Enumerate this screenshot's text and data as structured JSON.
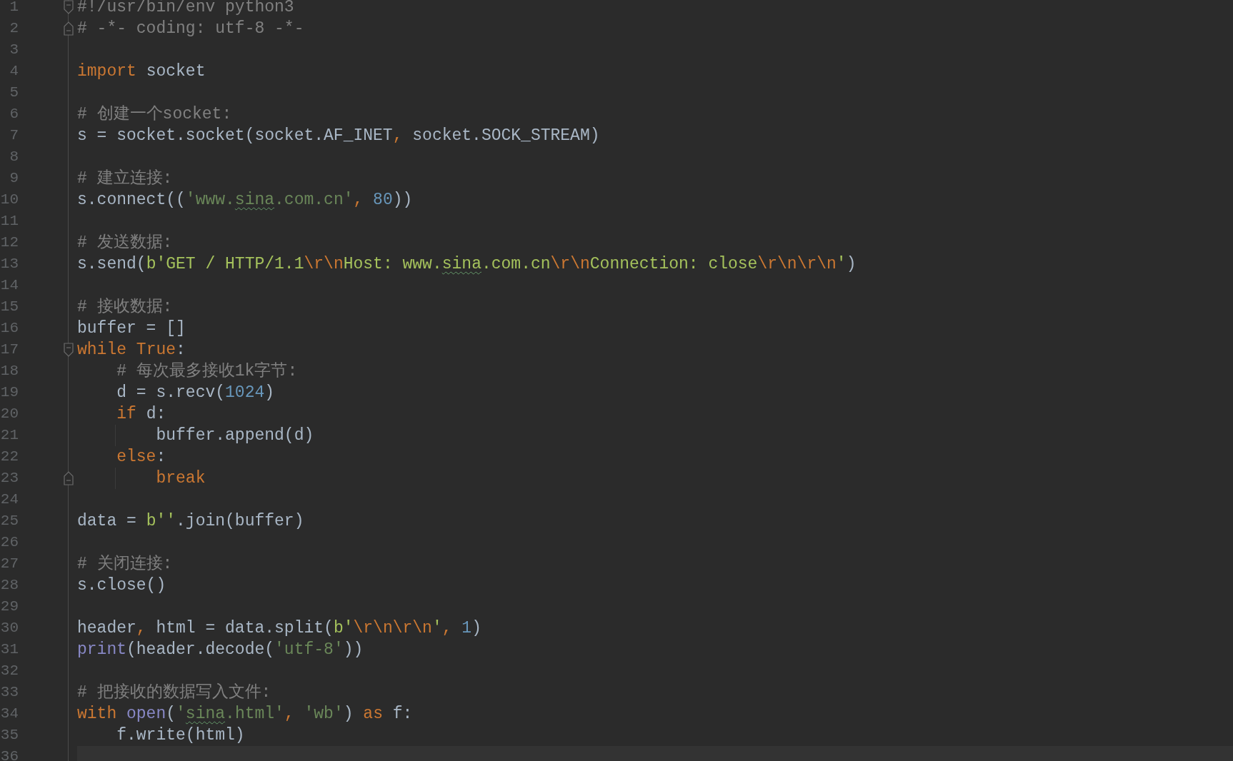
{
  "editor": {
    "lines": [
      {
        "number": "1",
        "marker": {
          "kind": "fold_start"
        },
        "tokens": [
          {
            "kind": "comment",
            "text": "#!/usr/bin/env python3"
          }
        ]
      },
      {
        "number": "2",
        "marker": {
          "kind": "fold_end"
        },
        "tokens": [
          {
            "kind": "comment",
            "text": "# -*- coding: utf-8 -*-"
          }
        ]
      },
      {
        "number": "3"
      },
      {
        "number": "4",
        "tokens": [
          {
            "kind": "keyword",
            "text": "import"
          },
          {
            "kind": "plain",
            "text": " socket"
          }
        ]
      },
      {
        "number": "5"
      },
      {
        "number": "6",
        "tokens": [
          {
            "kind": "comment",
            "text": "# 创建一个socket:"
          }
        ]
      },
      {
        "number": "7",
        "tokens": [
          {
            "kind": "plain",
            "text": "s = socket.socket(socket.AF_INET"
          },
          {
            "kind": "punct",
            "text": ","
          },
          {
            "kind": "plain",
            "text": " socket.SOCK_STREAM)"
          }
        ]
      },
      {
        "number": "8"
      },
      {
        "number": "9",
        "tokens": [
          {
            "kind": "comment",
            "text": "# 建立连接:"
          }
        ]
      },
      {
        "number": "10",
        "tokens": [
          {
            "kind": "plain",
            "text": "s.connect(("
          },
          {
            "kind": "string",
            "text": "'www."
          },
          {
            "kind": "typo_string",
            "text": "sina"
          },
          {
            "kind": "string",
            "text": ".com.cn'"
          },
          {
            "kind": "punct",
            "text": ", "
          },
          {
            "kind": "number",
            "text": "80"
          },
          {
            "kind": "plain",
            "text": "))"
          }
        ]
      },
      {
        "number": "11"
      },
      {
        "number": "12",
        "tokens": [
          {
            "kind": "comment",
            "text": "# 发送数据:"
          }
        ]
      },
      {
        "number": "13",
        "tokens": [
          {
            "kind": "plain",
            "text": "s.send("
          },
          {
            "kind": "bytes",
            "text": "b'GET / HTTP/1.1"
          },
          {
            "kind": "escape",
            "text": "\\r\\n"
          },
          {
            "kind": "bytes",
            "text": "Host: www."
          },
          {
            "kind": "typo_bytes",
            "text": "sina"
          },
          {
            "kind": "bytes",
            "text": ".com.cn"
          },
          {
            "kind": "escape",
            "text": "\\r\\n"
          },
          {
            "kind": "bytes",
            "text": "Connection: close"
          },
          {
            "kind": "escape",
            "text": "\\r\\n\\r\\n"
          },
          {
            "kind": "bytes",
            "text": "'"
          },
          {
            "kind": "plain",
            "text": ")"
          }
        ]
      },
      {
        "number": "14"
      },
      {
        "number": "15",
        "tokens": [
          {
            "kind": "comment",
            "text": "# 接收数据:"
          }
        ]
      },
      {
        "number": "16",
        "tokens": [
          {
            "kind": "plain",
            "text": "buffer = []"
          }
        ]
      },
      {
        "number": "17",
        "marker": {
          "kind": "fold_start"
        },
        "tokens": [
          {
            "kind": "keyword",
            "text": "while "
          },
          {
            "kind": "keyword",
            "text": "True"
          },
          {
            "kind": "plain",
            "text": ":"
          }
        ]
      },
      {
        "number": "18",
        "tokens": [
          {
            "kind": "comment",
            "text": "    # 每次最多接收1k字节:"
          }
        ]
      },
      {
        "number": "19",
        "tokens": [
          {
            "kind": "plain",
            "text": "    d = s.recv("
          },
          {
            "kind": "number",
            "text": "1024"
          },
          {
            "kind": "plain",
            "text": ")"
          }
        ]
      },
      {
        "number": "20",
        "tokens": [
          {
            "kind": "keyword",
            "text": "    if"
          },
          {
            "kind": "plain",
            "text": " d:"
          }
        ]
      },
      {
        "number": "21",
        "tokens": [
          {
            "kind": "plain",
            "text": "        buffer.append(d)"
          }
        ]
      },
      {
        "number": "22",
        "tokens": [
          {
            "kind": "keyword",
            "text": "    else"
          },
          {
            "kind": "plain",
            "text": ":"
          }
        ]
      },
      {
        "number": "23",
        "marker": {
          "kind": "fold_end"
        },
        "tokens": [
          {
            "kind": "keyword",
            "text": "        break"
          }
        ]
      },
      {
        "number": "24"
      },
      {
        "number": "25",
        "tokens": [
          {
            "kind": "plain",
            "text": "data = "
          },
          {
            "kind": "bytes",
            "text": "b''"
          },
          {
            "kind": "plain",
            "text": ".join(buffer)"
          }
        ]
      },
      {
        "number": "26"
      },
      {
        "number": "27",
        "tokens": [
          {
            "kind": "comment",
            "text": "# 关闭连接:"
          }
        ]
      },
      {
        "number": "28",
        "tokens": [
          {
            "kind": "plain",
            "text": "s.close()"
          }
        ]
      },
      {
        "number": "29"
      },
      {
        "number": "30",
        "tokens": [
          {
            "kind": "plain",
            "text": "header"
          },
          {
            "kind": "punct",
            "text": ","
          },
          {
            "kind": "plain",
            "text": " html = data.split("
          },
          {
            "kind": "bytes",
            "text": "b'"
          },
          {
            "kind": "escape",
            "text": "\\r\\n\\r\\n"
          },
          {
            "kind": "bytes",
            "text": "'"
          },
          {
            "kind": "punct",
            "text": ", "
          },
          {
            "kind": "number",
            "text": "1"
          },
          {
            "kind": "plain",
            "text": ")"
          }
        ]
      },
      {
        "number": "31",
        "tokens": [
          {
            "kind": "builtin",
            "text": "print"
          },
          {
            "kind": "plain",
            "text": "(header.decode("
          },
          {
            "kind": "string",
            "text": "'utf-8'"
          },
          {
            "kind": "plain",
            "text": "))"
          }
        ]
      },
      {
        "number": "32"
      },
      {
        "number": "33",
        "tokens": [
          {
            "kind": "comment",
            "text": "# 把接收的数据写入文件:"
          }
        ]
      },
      {
        "number": "34",
        "tokens": [
          {
            "kind": "keyword",
            "text": "with "
          },
          {
            "kind": "builtin",
            "text": "open"
          },
          {
            "kind": "plain",
            "text": "("
          },
          {
            "kind": "string",
            "text": "'"
          },
          {
            "kind": "typo_string",
            "text": "sina"
          },
          {
            "kind": "string",
            "text": ".html'"
          },
          {
            "kind": "punct",
            "text": ", "
          },
          {
            "kind": "string",
            "text": "'wb'"
          },
          {
            "kind": "plain",
            "text": ") "
          },
          {
            "kind": "keyword",
            "text": "as"
          },
          {
            "kind": "plain",
            "text": " f:"
          }
        ]
      },
      {
        "number": "35",
        "tokens": [
          {
            "kind": "plain",
            "text": "    f.write(html)"
          }
        ]
      },
      {
        "number": "36",
        "current": true
      }
    ]
  }
}
